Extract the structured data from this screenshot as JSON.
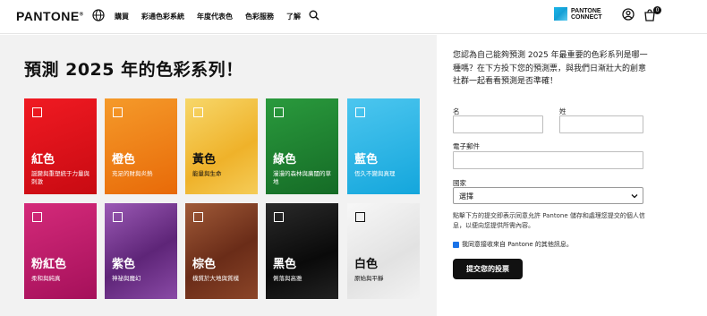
{
  "header": {
    "logo": "PANTONE",
    "nav": [
      "購買",
      "彩通色彩系統",
      "年度代表色",
      "色彩服務",
      "了解"
    ],
    "connect_line1": "PANTONE",
    "connect_line2": "CONNECT",
    "cart_count": "0",
    "icons": [
      "globe-icon",
      "search-icon",
      "pantone-connect-logo",
      "user-icon",
      "shopping-bag-icon"
    ]
  },
  "main": {
    "title": "預測 2025 年的色彩系列！",
    "tiles": [
      {
        "name": "紅色",
        "desc": "誕變與重塑統于力量與刺激",
        "color": "#e20f18"
      },
      {
        "name": "橙色",
        "desc": "充足的財與炎熱",
        "color": "#ef7a12"
      },
      {
        "name": "黃色",
        "desc": "能量與生命",
        "color": "#f2c23a"
      },
      {
        "name": "綠色",
        "desc": "漫漫的森林與廣闊的草地",
        "color": "#1d8a33"
      },
      {
        "name": "藍色",
        "desc": "恆久不變與真理",
        "color": "#25b5e6"
      },
      {
        "name": "粉紅色",
        "desc": "柔和與純真",
        "color": "#c2186b"
      },
      {
        "name": "紫色",
        "desc": "神祕與魔幻",
        "color": "#7a3d94"
      },
      {
        "name": "棕色",
        "desc": "樸質於大地與質樸",
        "color": "#7e3a22"
      },
      {
        "name": "黑色",
        "desc": "俐落與高雅",
        "color": "#151515"
      },
      {
        "name": "白色",
        "desc": "原始與平靜",
        "color": "#efefef"
      }
    ]
  },
  "form": {
    "intro": "您認為自己能夠預測 2025 年最重要的色彩系列是哪一種嗎？在下方投下您的預測票，與我們日漸壯大的創意社群一起看看預測是否準確！",
    "first_name_label": "名",
    "last_name_label": "姓",
    "email_label": "電子郵件",
    "country_label": "國家",
    "country_value": "選擇",
    "consent": "點擊下方的提交即表示同意允許 Pantone 儲存和處理您提交的個人信息，以便向您提供所需內容。",
    "opt_in_label": "我同意接收來自 Pantone 的其他訊息。",
    "opt_in_checked": true,
    "submit_label": "提交您的投票"
  }
}
